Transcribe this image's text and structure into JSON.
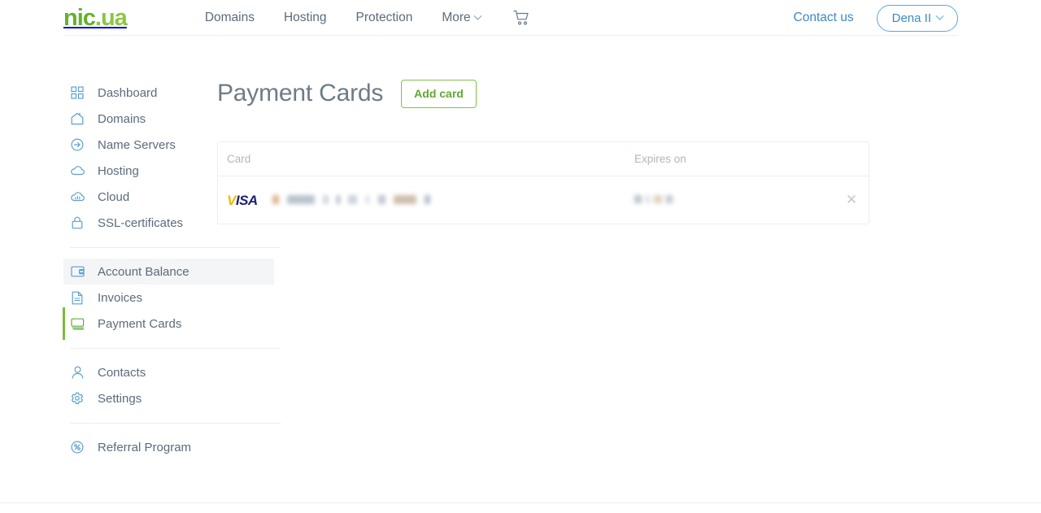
{
  "brand": {
    "logo_nic": "nic",
    "logo_dot": ".",
    "logo_ua": "ua",
    "green_dark": "#63b22a",
    "green_light": "#8cc63f",
    "accent_blue": "#3e89c4",
    "accent_green": "#79bd3f"
  },
  "header": {
    "nav": [
      {
        "label": "Domains",
        "icon": "none"
      },
      {
        "label": "Hosting",
        "icon": "none"
      },
      {
        "label": "Protection",
        "icon": "none"
      },
      {
        "label": "More",
        "icon": "chevron-down-icon"
      }
    ],
    "cart_icon": "shopping-cart-icon",
    "contact_label": "Contact us",
    "user_label": "Dena II",
    "user_chevron": "chevron-down-icon"
  },
  "sidebar": {
    "groups": [
      {
        "items": [
          {
            "label": "Dashboard",
            "icon": "grid-icon",
            "state": "normal"
          },
          {
            "label": "Domains",
            "icon": "house-icon",
            "state": "normal"
          },
          {
            "label": "Name Servers",
            "icon": "arrow-circle-icon",
            "state": "normal"
          },
          {
            "label": "Hosting",
            "icon": "cloud-icon",
            "state": "normal"
          },
          {
            "label": "Cloud",
            "icon": "cloud-chart-icon",
            "state": "normal"
          },
          {
            "label": "SSL-certificates",
            "icon": "lock-icon",
            "state": "normal"
          }
        ]
      },
      {
        "items": [
          {
            "label": "Account Balance",
            "icon": "balance-card-icon",
            "state": "hovered"
          },
          {
            "label": "Invoices",
            "icon": "document-icon",
            "state": "normal"
          },
          {
            "label": "Payment Cards",
            "icon": "cards-stack-icon",
            "state": "active"
          }
        ]
      },
      {
        "items": [
          {
            "label": "Contacts",
            "icon": "person-icon",
            "state": "normal"
          },
          {
            "label": "Settings",
            "icon": "gear-icon",
            "state": "normal"
          }
        ]
      },
      {
        "items": [
          {
            "label": "Referral Program",
            "icon": "percent-circle-icon",
            "state": "normal"
          }
        ]
      }
    ]
  },
  "main": {
    "title": "Payment Cards",
    "add_card_label": "Add card",
    "table": {
      "columns": [
        "Card",
        "Expires on"
      ],
      "rows": [
        {
          "brand": "VISA",
          "brand_mark_first": "V",
          "brand_mark_rest": "ISA",
          "number": "",
          "number_redacted": true,
          "expires": "",
          "expires_redacted": true,
          "remove_icon": "close-icon"
        }
      ]
    }
  }
}
